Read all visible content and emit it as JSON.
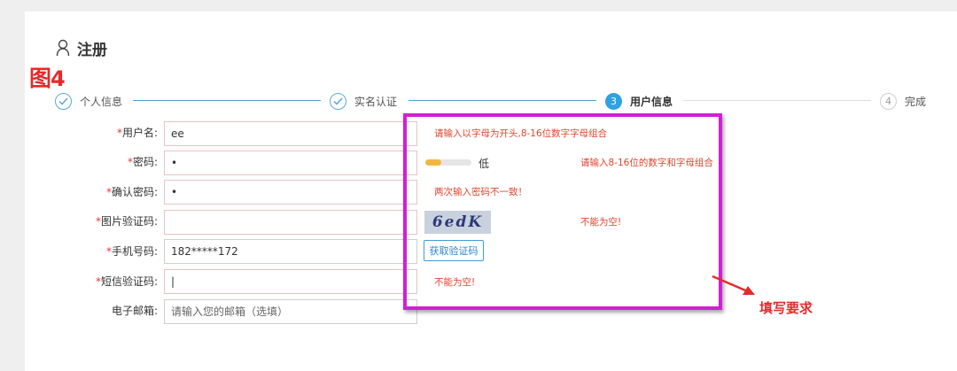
{
  "page": {
    "title": "注册",
    "figure_label_text": "图",
    "figure_label_num": "4"
  },
  "steps": [
    {
      "label": "个人信息",
      "state": "done"
    },
    {
      "label": "实名认证",
      "state": "done"
    },
    {
      "label": "用户信息",
      "state": "active",
      "number": "3"
    },
    {
      "label": "完成",
      "state": "todo",
      "number": "4"
    }
  ],
  "form": {
    "username": {
      "label": "用户名",
      "required": "*",
      "value": "ee",
      "error": "请输入以字母为开头,8-16位数字字母组合"
    },
    "password": {
      "label": "密码",
      "required": "*",
      "value": "•",
      "strength_text": "低",
      "strength_level": 0.35,
      "error": "请输入8-16位的数字和字母组合"
    },
    "confirm_password": {
      "label": "确认密码",
      "required": "*",
      "value": "•",
      "error": "两次输入密码不一致！"
    },
    "captcha": {
      "label": "图片验证码",
      "required": "*",
      "value": "",
      "image_text": "6edK",
      "error": "不能为空!"
    },
    "phone": {
      "label": "手机号码",
      "required": "*",
      "value": "182*****172",
      "sms_button": "获取验证码"
    },
    "sms_code": {
      "label": "短信验证码",
      "required": "*",
      "value": "|",
      "error": "不能为空!"
    },
    "email": {
      "label": "电子邮箱",
      "value": "",
      "placeholder": "请输入您的邮箱（选填）"
    }
  },
  "annotation": {
    "note": "填写要求",
    "box_color": "#d21ed6",
    "arrow_color": "#e32b2b"
  },
  "colors": {
    "accent": "#2ea2e0",
    "error": "#e2442e",
    "strength": "#f2b640"
  }
}
